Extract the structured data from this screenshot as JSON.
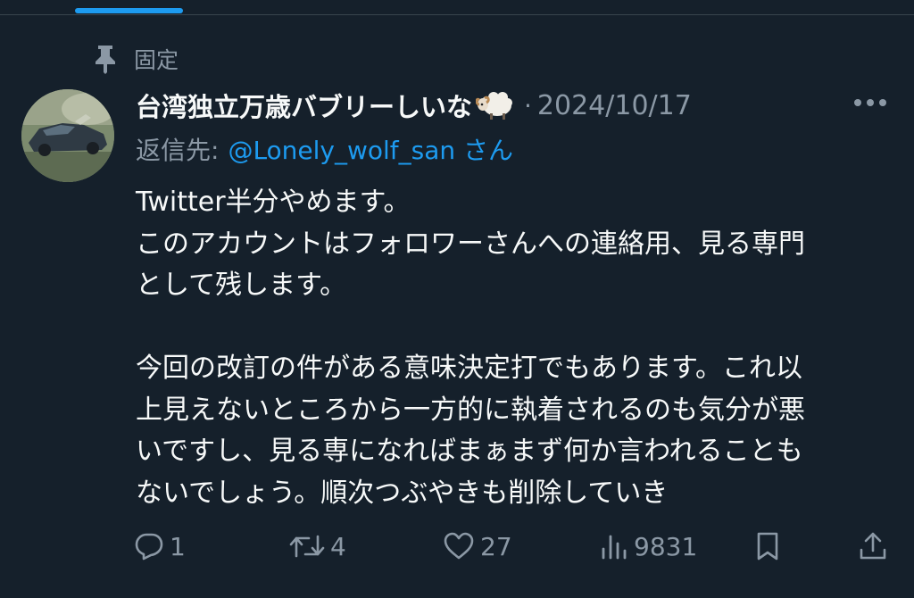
{
  "pinned": {
    "label": "固定",
    "icon": "pin-icon"
  },
  "tweet": {
    "avatar": "avatar-car-photo",
    "display_name": "台湾独立万歳バブリーしいな",
    "name_emoji": "sheep-emoji",
    "separator": "·",
    "date": "2024/10/17",
    "more_icon": "more-options-icon",
    "reply_to": {
      "prefix": "返信先:",
      "mention": "@Lonely_wolf_san さん"
    },
    "body_lines": [
      "Twitter半分やめます。",
      "このアカウントはフォロワーさんへの連絡用、見る専門",
      "として残します。",
      "",
      "今回の改訂の件がある意味決定打でもあります。これ以",
      "上見えないところから一方的に執着されるのも気分が悪",
      "いですし、見る専になればまぁまず何か言われることも",
      "ないでしょう。順次つぶやきも削除していき"
    ]
  },
  "actions": {
    "reply": {
      "icon": "reply-icon",
      "count": "1"
    },
    "retweet": {
      "icon": "retweet-icon",
      "count": "4"
    },
    "like": {
      "icon": "heart-icon",
      "count": "27"
    },
    "views": {
      "icon": "views-icon",
      "count": "9831"
    },
    "bookmark": {
      "icon": "bookmark-icon"
    },
    "share": {
      "icon": "share-icon"
    }
  },
  "colors": {
    "background": "#15202b",
    "text_primary": "#f7f9f9",
    "text_secondary": "#8b98a5",
    "accent": "#1d9bf0"
  }
}
